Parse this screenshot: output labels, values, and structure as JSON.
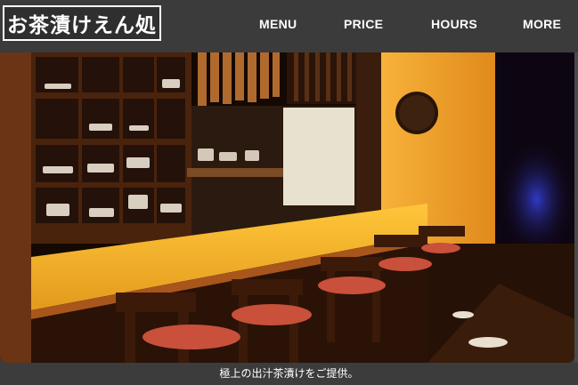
{
  "header": {
    "logo_text": "お茶漬けえん処"
  },
  "nav": {
    "items": [
      {
        "label": "MENU"
      },
      {
        "label": "PRICE"
      },
      {
        "label": "HOURS"
      },
      {
        "label": "MORE"
      }
    ]
  },
  "hero": {
    "caption": "極上の出汁茶漬けをご提供。"
  },
  "colors": {
    "header_bg": "#3b3b3b",
    "caption_bg": "#3c3c3c",
    "warm_light": "#f0a531",
    "wood_dark": "#3a1d0c"
  }
}
